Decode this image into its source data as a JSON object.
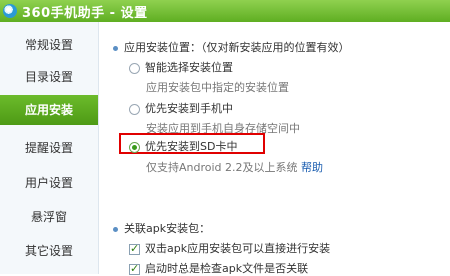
{
  "window": {
    "title": "360手机助手 - 设置"
  },
  "sidebar": {
    "items": [
      {
        "label": "常规设置",
        "active": false
      },
      {
        "label": "目录设置",
        "active": false
      },
      {
        "label": "应用安装",
        "active": true
      },
      {
        "label": "提醒设置",
        "active": false
      },
      {
        "label": "用户设置",
        "active": false
      },
      {
        "label": "悬浮窗",
        "active": false
      },
      {
        "label": "其它设置",
        "active": false
      }
    ]
  },
  "install_location": {
    "header": "应用安装位置：（仅对新安装应用的位置有效）",
    "options": [
      {
        "label": "智能选择安装位置",
        "desc": "应用安装包中指定的安装位置",
        "selected": false
      },
      {
        "label": "优先安装到手机中",
        "desc": "安装应用到手机自身存储空间中",
        "selected": false
      },
      {
        "label": "优先安装到SD卡中",
        "desc": "仅支持Android 2.2及以上系统",
        "selected": true
      }
    ],
    "help_label": "帮助"
  },
  "apk_association": {
    "header": "关联apk安装包：",
    "checkboxes": [
      {
        "label": "双击apk应用安装包可以直接进行安装",
        "checked": true
      },
      {
        "label": "启动时总是检查apk文件是否关联",
        "checked": true
      }
    ]
  },
  "colors": {
    "accent_green": "#5fae22",
    "highlight_red": "#e00000",
    "link_blue": "#1a5db0"
  }
}
